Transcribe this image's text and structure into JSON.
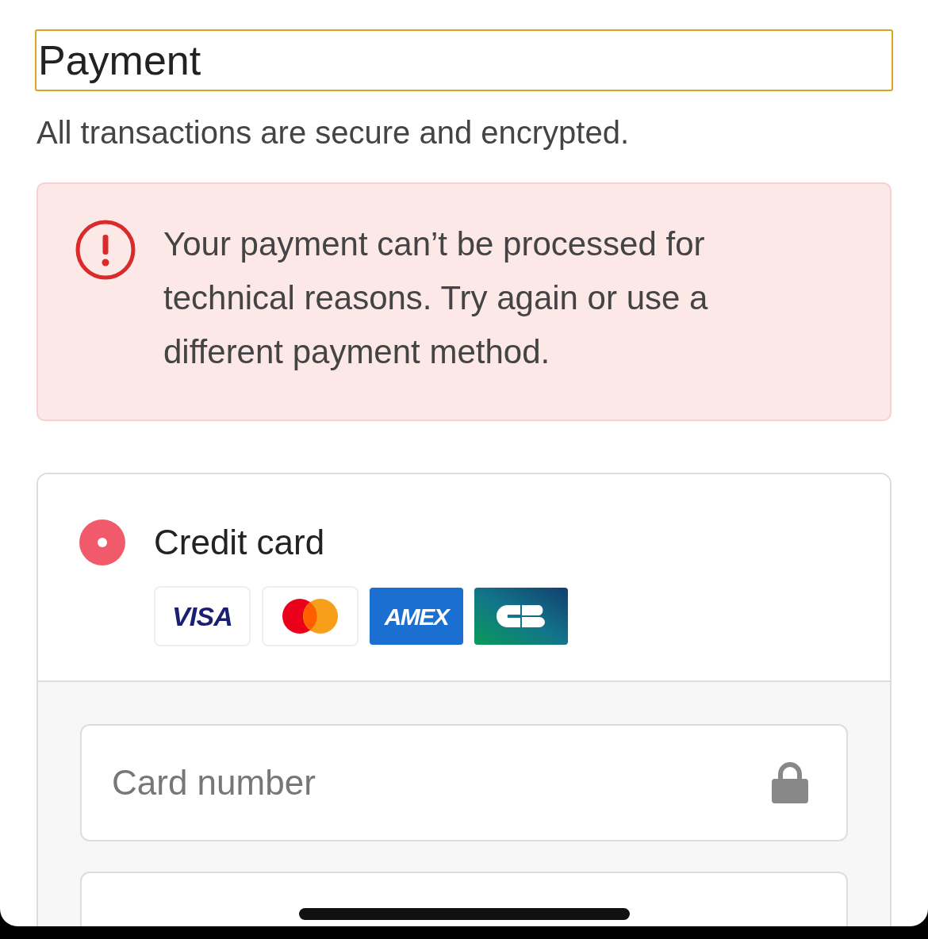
{
  "heading": "Payment",
  "subtitle": "All transactions are secure and encrypted.",
  "alert": {
    "message": "Your payment can’t be processed for technical reasons. Try again or use a different payment method."
  },
  "payment_methods": [
    {
      "label": "Credit card",
      "selected": true,
      "cards": [
        {
          "kind": "visa",
          "label": "VISA"
        },
        {
          "kind": "mastercard"
        },
        {
          "kind": "amex",
          "label": "AMEX"
        },
        {
          "kind": "cb"
        }
      ],
      "fields": [
        {
          "placeholder": "Card number",
          "kind": "lock"
        }
      ]
    }
  ]
}
